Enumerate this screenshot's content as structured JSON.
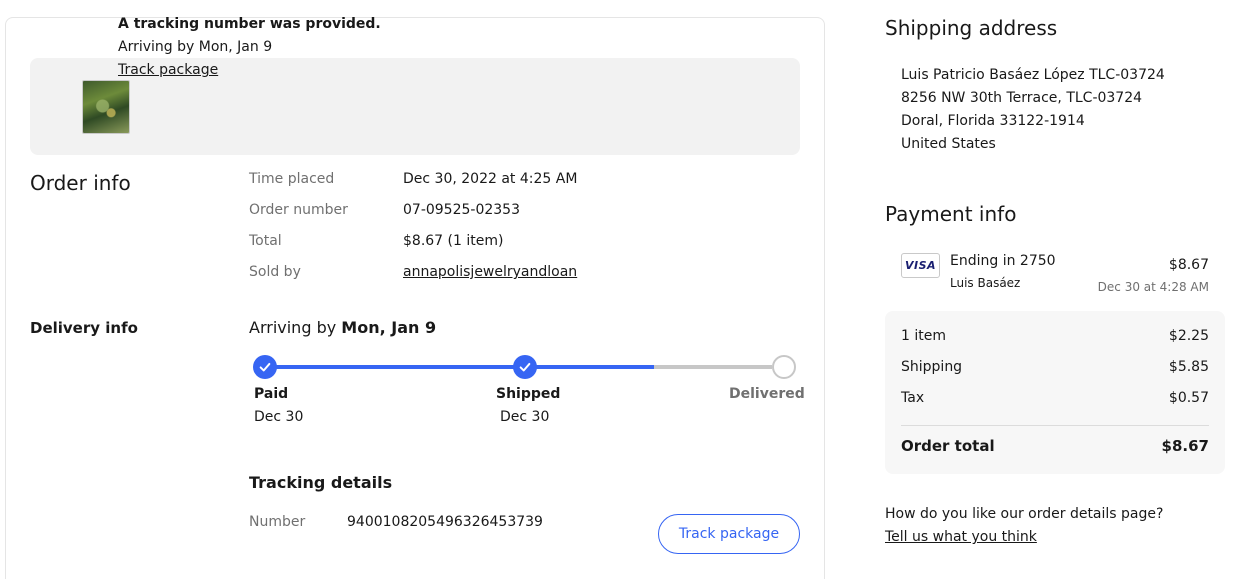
{
  "notice": {
    "title": "A tracking number was provided.",
    "eta": "Arriving by Mon, Jan 9",
    "link": "Track package"
  },
  "order_info": {
    "title": "Order info",
    "rows": [
      {
        "label": "Time placed",
        "value": "Dec 30, 2022 at 4:25 AM"
      },
      {
        "label": "Order number",
        "value": "07-09525-02353"
      },
      {
        "label": "Total",
        "value": "$8.67 (1 item)"
      },
      {
        "label": "Sold by",
        "value": "annapolisjewelryandloan"
      }
    ]
  },
  "delivery_info": {
    "title": "Delivery info",
    "arriving_prefix": "Arriving by",
    "arriving_date": "Mon, Jan 9",
    "progress_fraction": 0.75,
    "steps": [
      {
        "label": "Paid",
        "date": "Dec 30",
        "done": true
      },
      {
        "label": "Shipped",
        "date": "Dec 30",
        "done": true
      },
      {
        "label": "Delivered",
        "date": "",
        "done": false
      }
    ],
    "tracking_title": "Tracking details",
    "tracking_label": "Number",
    "tracking_number": "9400108205496326453739",
    "track_button": "Track package"
  },
  "shipping_address": {
    "title": "Shipping address",
    "lines": [
      "Luis Patricio Basáez López TLC-03724",
      "8256 NW 30th Terrace, TLC-03724",
      "Doral, Florida 33122-1914",
      "United States"
    ]
  },
  "payment_info": {
    "title": "Payment info",
    "card_brand": "VISA",
    "ending": "Ending in 2750",
    "cardholder": "Luis Basáez",
    "amount": "$8.67",
    "date": "Dec 30 at 4:28 AM",
    "summary": [
      {
        "label": "1 item",
        "value": "$2.25"
      },
      {
        "label": "Shipping",
        "value": "$5.85"
      },
      {
        "label": "Tax",
        "value": "$0.57"
      }
    ],
    "total_label": "Order total",
    "total_value": "$8.67"
  },
  "feedback": {
    "question": "How do you like our order details page?",
    "link": "Tell us what you think"
  },
  "colors": {
    "accent": "#3665f3",
    "pending": "#c7c7c7",
    "muted_text": "#707070"
  }
}
